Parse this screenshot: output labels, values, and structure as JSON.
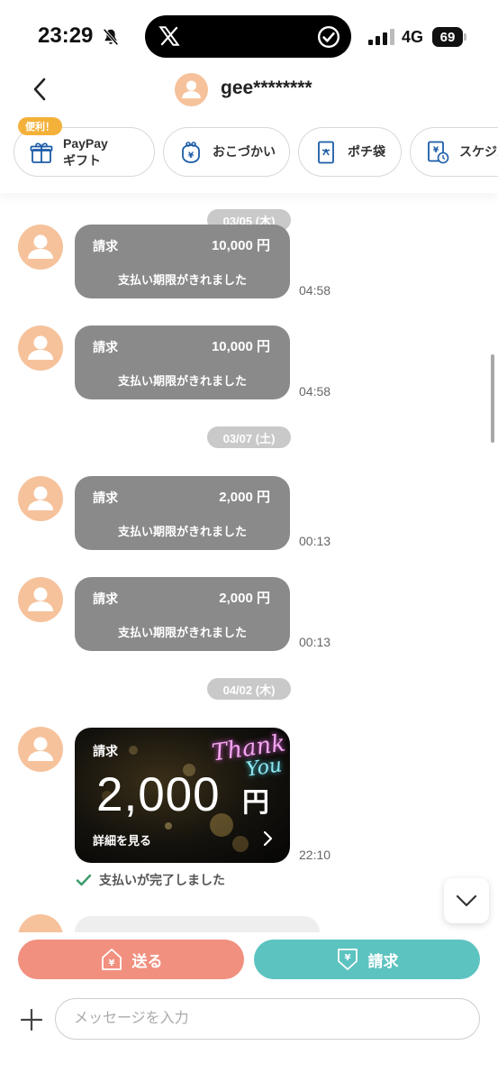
{
  "status_bar": {
    "time": "23:29",
    "network": "4G",
    "battery": "69"
  },
  "header": {
    "name": "gee********"
  },
  "quick_actions": {
    "badge": "便利！",
    "items": [
      {
        "line1": "PayPay",
        "line2": "ギフト",
        "icon": "gift-icon"
      },
      {
        "label": "おこづかい",
        "icon": "coin-purse-icon"
      },
      {
        "label": "ポチ袋",
        "icon": "envelope-icon"
      },
      {
        "label": "スケジュール",
        "icon": "schedule-icon"
      }
    ]
  },
  "messages": [
    {
      "date": "03/05 (木)"
    },
    {
      "kind": "請求",
      "amount": "10,000 円",
      "status": "支払い期限がきれました",
      "time": "04:58"
    },
    {
      "kind": "請求",
      "amount": "10,000 円",
      "status": "支払い期限がきれました",
      "time": "04:58"
    },
    {
      "date": "03/07 (土)"
    },
    {
      "kind": "請求",
      "amount": "2,000 円",
      "status": "支払い期限がきれました",
      "time": "00:13"
    },
    {
      "kind": "請求",
      "amount": "2,000 円",
      "status": "支払い期限がきれました",
      "time": "00:13"
    },
    {
      "date": "04/02 (木)"
    }
  ],
  "card": {
    "kind": "請求",
    "amount": "2,000",
    "currency": "円",
    "deco_line1": "Thank",
    "deco_line2": "You",
    "detail": "詳細を見る",
    "time": "22:10",
    "paid_status": "支払いが完了しました"
  },
  "actions": {
    "send": "送る",
    "request": "請求",
    "input_placeholder": "メッセージを入力"
  },
  "colors": {
    "avatar": "#f6c29b",
    "send": "#f1907f",
    "request": "#5cc3c0",
    "expired_bubble": "#8a8a8a",
    "paid_check": "#3a9a6a"
  }
}
